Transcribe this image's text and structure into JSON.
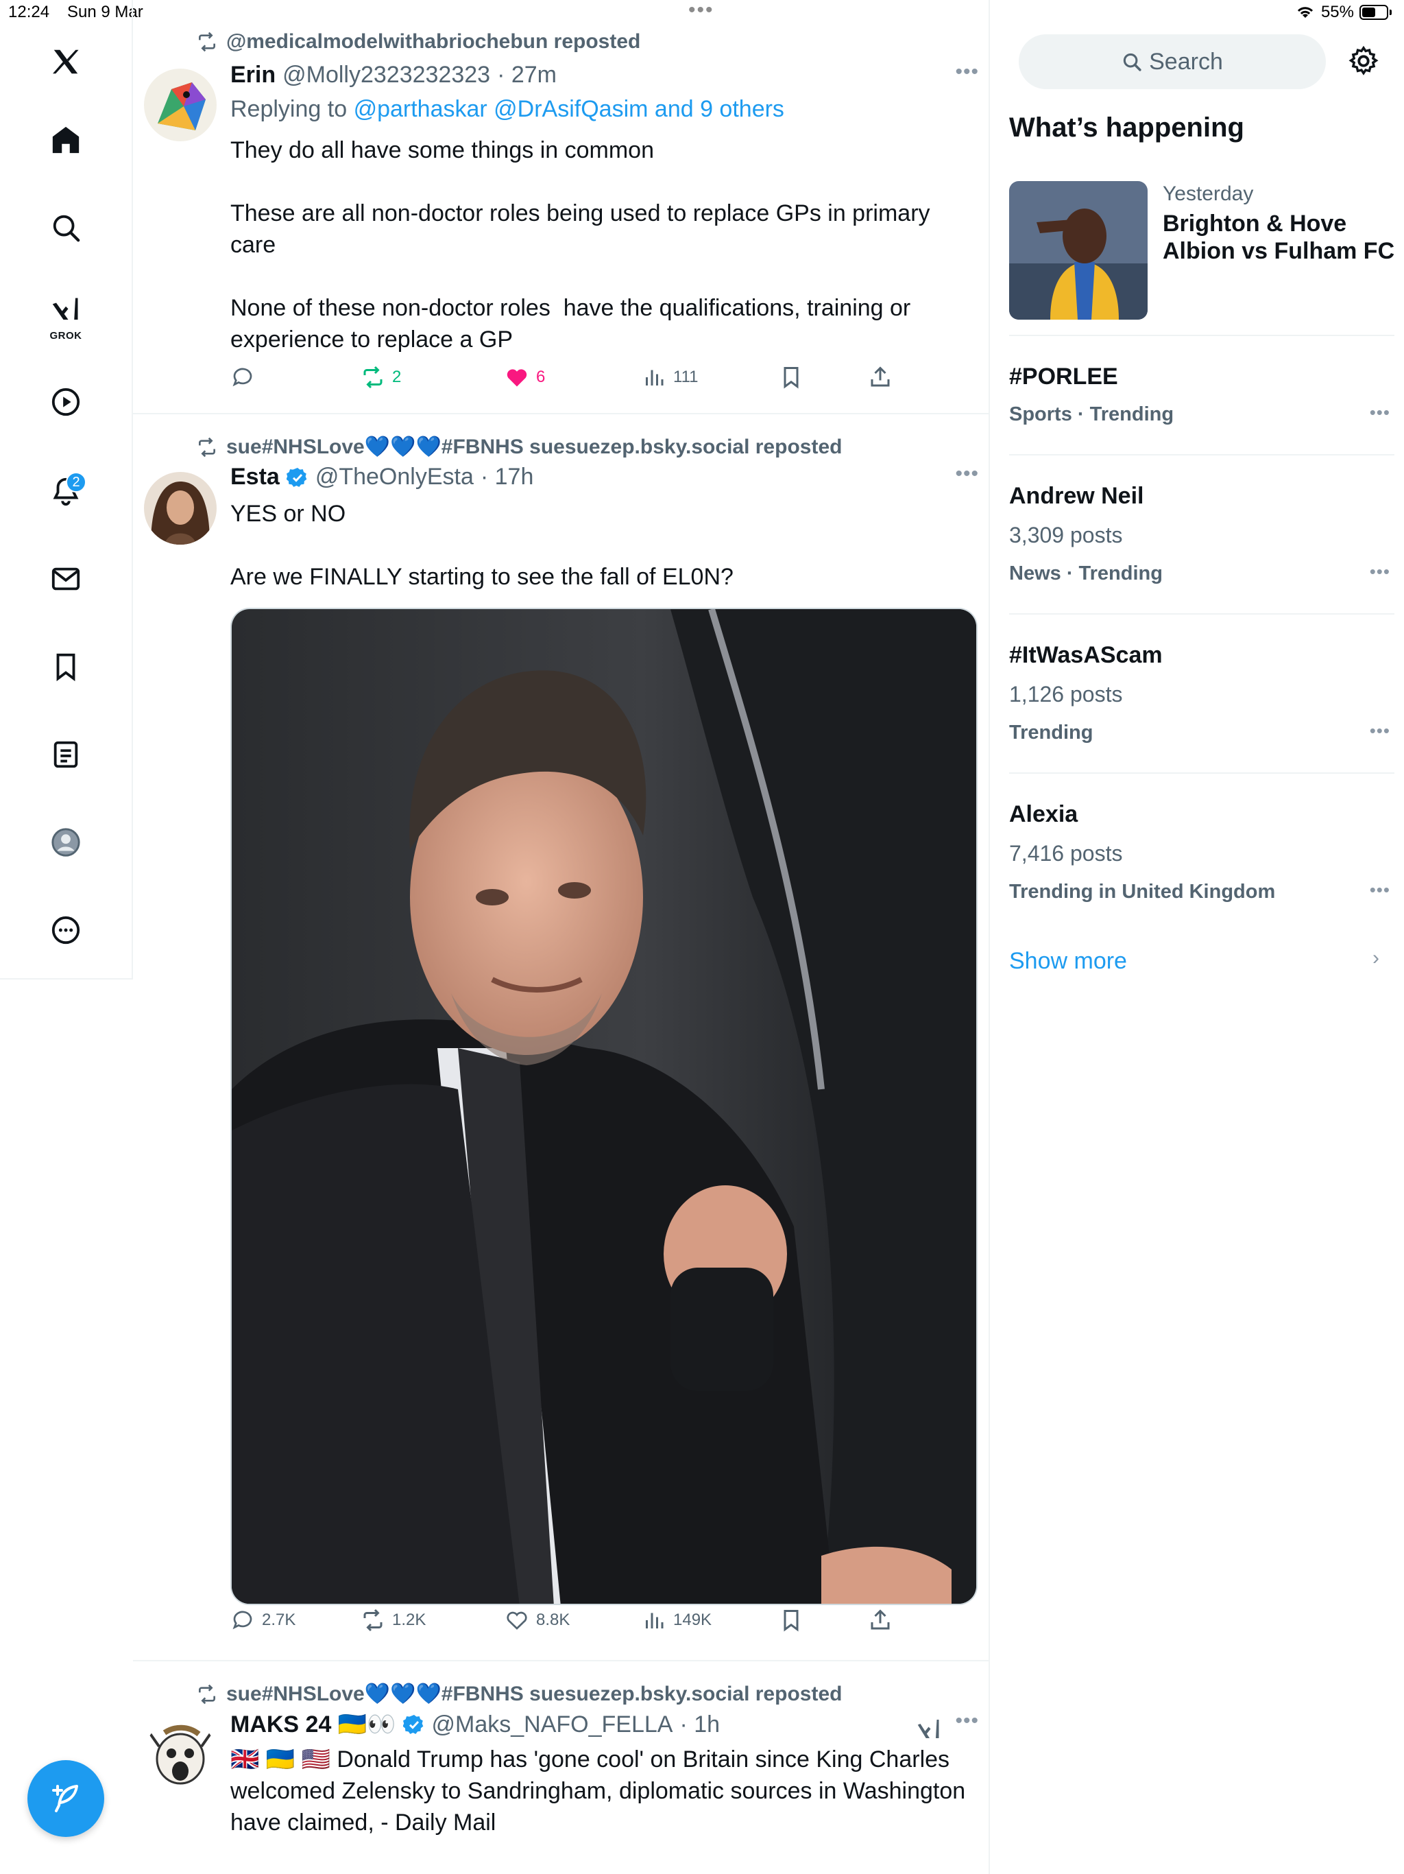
{
  "status_bar": {
    "time": "12:24",
    "date": "Sun 9 Mar",
    "battery": "55%",
    "battery_level": 0.55
  },
  "nav": {
    "logo": "x-logo-icon",
    "items": [
      "home-icon",
      "search-icon",
      "grok-icon",
      "video-icon",
      "notifications-icon",
      "messages-icon",
      "bookmarks-icon",
      "lists-icon",
      "profile-icon",
      "more-icon"
    ],
    "grok_label": "GROK",
    "notifications_badge": "2",
    "compose": "compose-post-icon"
  },
  "posts": [
    {
      "reposted_by": "@medicalmodelwithabriochebun reposted",
      "name": "Erin",
      "handle": "@Molly2323232323",
      "time": "· 27m",
      "reply_prefix": "Replying to",
      "reply_targets": "@parthaskar @DrAsifQasim and 9 others",
      "text": "They do all have some things in common\n\nThese are all non-doctor roles being used to replace GPs in primary care\n\nNone of these non-doctor roles  have the qualifications, training or experience to replace a GP",
      "replies": "",
      "reposts": "2",
      "likes": "6",
      "views": "111"
    },
    {
      "reposted_by": "sue#NHSLove💙💙💙#FBNHS suesuezep.bsky.social reposted",
      "name": "Esta",
      "handle": "@TheOnlyEsta",
      "time": "· 17h",
      "text": "YES or NO\n\nAre we FINALLY starting to see the fall of EL0N?",
      "replies": "2.7K",
      "reposts": "1.2K",
      "likes": "8.8K",
      "views": "149K"
    },
    {
      "reposted_by": "sue#NHSLove💙💙💙#FBNHS suesuezep.bsky.social reposted",
      "name": "MAKS 24 🇺🇦👀",
      "handle": "@Maks_NAFO_FELLA",
      "time": "· 1h",
      "text": "🇬🇧 🇺🇦 🇺🇸 Donald Trump has 'gone cool' on Britain since King Charles welcomed Zelensky to Sandringham, diplomatic sources in Washington have claimed, - Daily Mail"
    }
  ],
  "sidebar": {
    "search_placeholder": "Search",
    "heading": "What’s happening",
    "event": {
      "when": "Yesterday",
      "title": "Brighton & Hove Albion vs Fulham FC"
    },
    "trends": [
      {
        "title": "#PORLEE",
        "count": "",
        "meta": "Sports · Trending"
      },
      {
        "title": "Andrew Neil",
        "count": "3,309 posts",
        "meta": "News · Trending"
      },
      {
        "title": "#ItWasAScam",
        "count": "1,126 posts",
        "meta": "Trending"
      },
      {
        "title": "Alexia",
        "count": "7,416 posts",
        "meta": "Trending in United Kingdom"
      }
    ],
    "show_more": "Show more"
  },
  "colors": {
    "accent": "#1d9bf0",
    "repost_active": "#00ba7c",
    "like_active": "#f91880",
    "muted": "#536471"
  }
}
